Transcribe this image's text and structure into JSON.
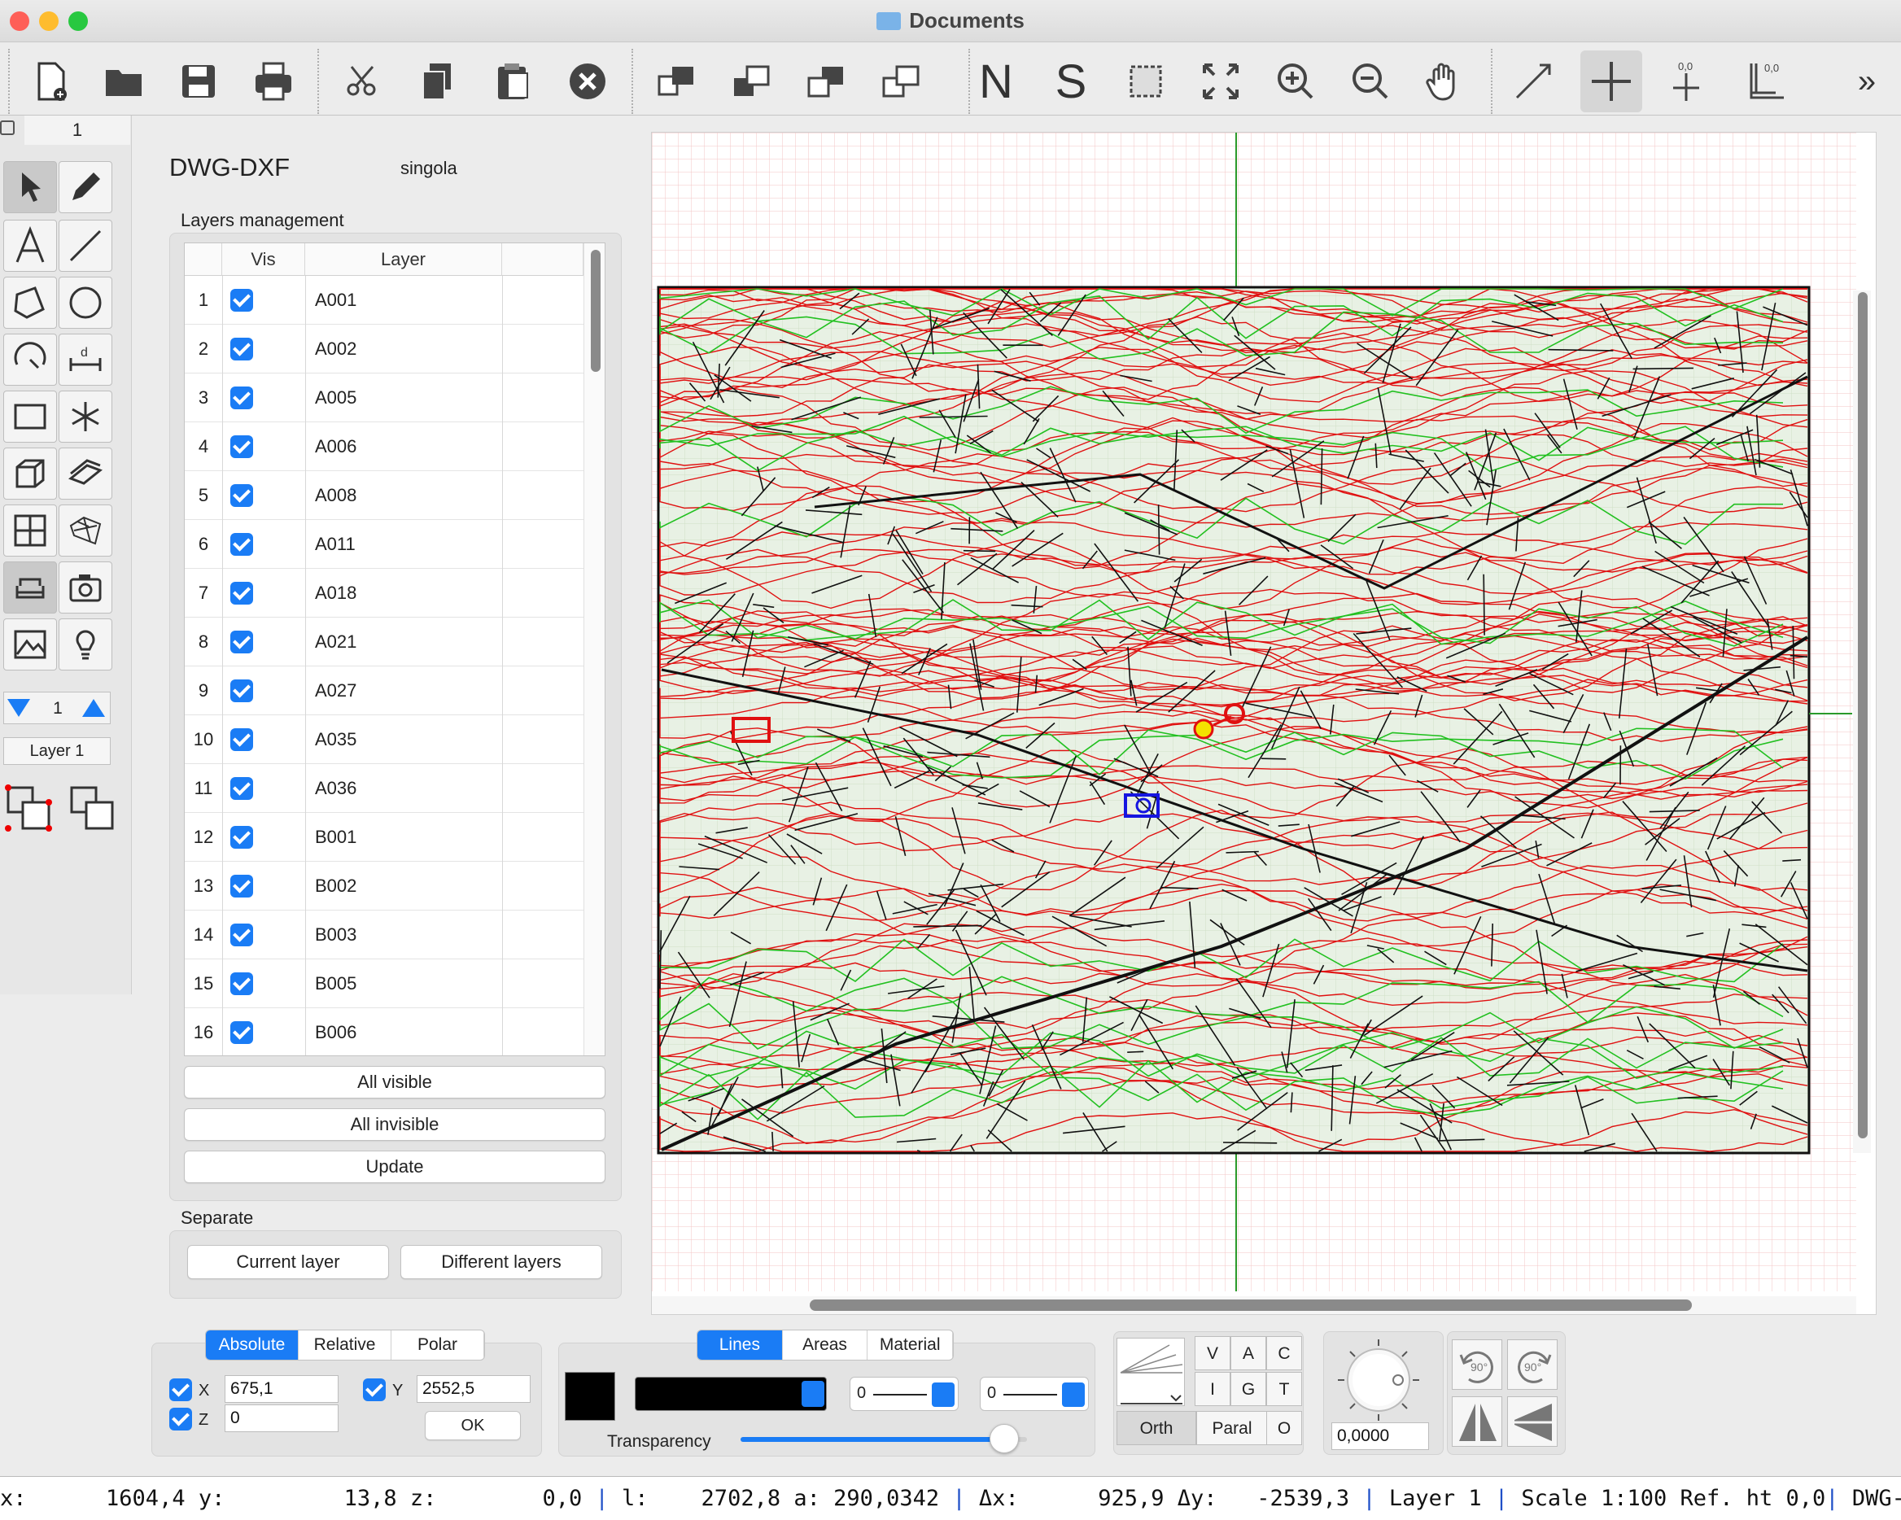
{
  "window": {
    "title": "Documents"
  },
  "toolbar": {
    "n_label": "N",
    "s_label": "S",
    "coord_zero_1": "0,0",
    "coord_zero_2": "0,0",
    "overflow": "»"
  },
  "left": {
    "layer_count": "1",
    "page_num": "1",
    "layer_name": "Layer 1"
  },
  "panel": {
    "title": "DWG-DXF",
    "mode": "singola",
    "layers_heading": "Layers management",
    "col_vis": "Vis",
    "col_layer": "Layer",
    "rows": [
      {
        "n": "1",
        "name": "A001"
      },
      {
        "n": "2",
        "name": "A002"
      },
      {
        "n": "3",
        "name": "A005"
      },
      {
        "n": "4",
        "name": "A006"
      },
      {
        "n": "5",
        "name": "A008"
      },
      {
        "n": "6",
        "name": "A011"
      },
      {
        "n": "7",
        "name": "A018"
      },
      {
        "n": "8",
        "name": "A021"
      },
      {
        "n": "9",
        "name": "A027"
      },
      {
        "n": "10",
        "name": "A035"
      },
      {
        "n": "11",
        "name": "A036"
      },
      {
        "n": "12",
        "name": "B001"
      },
      {
        "n": "13",
        "name": "B002"
      },
      {
        "n": "14",
        "name": "B003"
      },
      {
        "n": "15",
        "name": "B005"
      },
      {
        "n": "16",
        "name": "B006"
      }
    ],
    "all_visible": "All visible",
    "all_invisible": "All invisible",
    "update": "Update",
    "separate_heading": "Separate",
    "current_layer": "Current layer",
    "different_layers": "Different layers"
  },
  "coords": {
    "tabs": [
      "Absolute",
      "Relative",
      "Polar"
    ],
    "x_label": "X",
    "x_value": "675,1",
    "y_label": "Y",
    "y_value": "2552,5",
    "z_label": "Z",
    "z_value": "0",
    "ok": "OK"
  },
  "style": {
    "tabs": [
      "Lines",
      "Areas",
      "Material"
    ],
    "stepper1": "0",
    "stepper2": "0",
    "transparency_label": "Transparency",
    "transparency_level": 0.92,
    "color": "#000000"
  },
  "snap": {
    "v": "V",
    "a": "A",
    "c": "C",
    "i": "I",
    "g": "G",
    "t": "T",
    "orth": "Orth",
    "paral": "Paral",
    "o": "O"
  },
  "rotation": {
    "angle": "0,0000",
    "rot_left": "90°",
    "rot_right": "90°"
  },
  "status": {
    "x": "x:      1604,4 y:         13,8 z:        0,0 ",
    "l": " l:    2702,8 a: 290,0342 ",
    "dx": " Δx:      925,9 Δy:   -2539,3",
    "layer": " Layer 1",
    "scale": " Scale 1:100 Ref. ht 0,0",
    "mode": " DWG-DXF "
  },
  "colors": {
    "accent": "#1a7cf5",
    "map_red": "#e01010",
    "map_green": "#22c020"
  }
}
